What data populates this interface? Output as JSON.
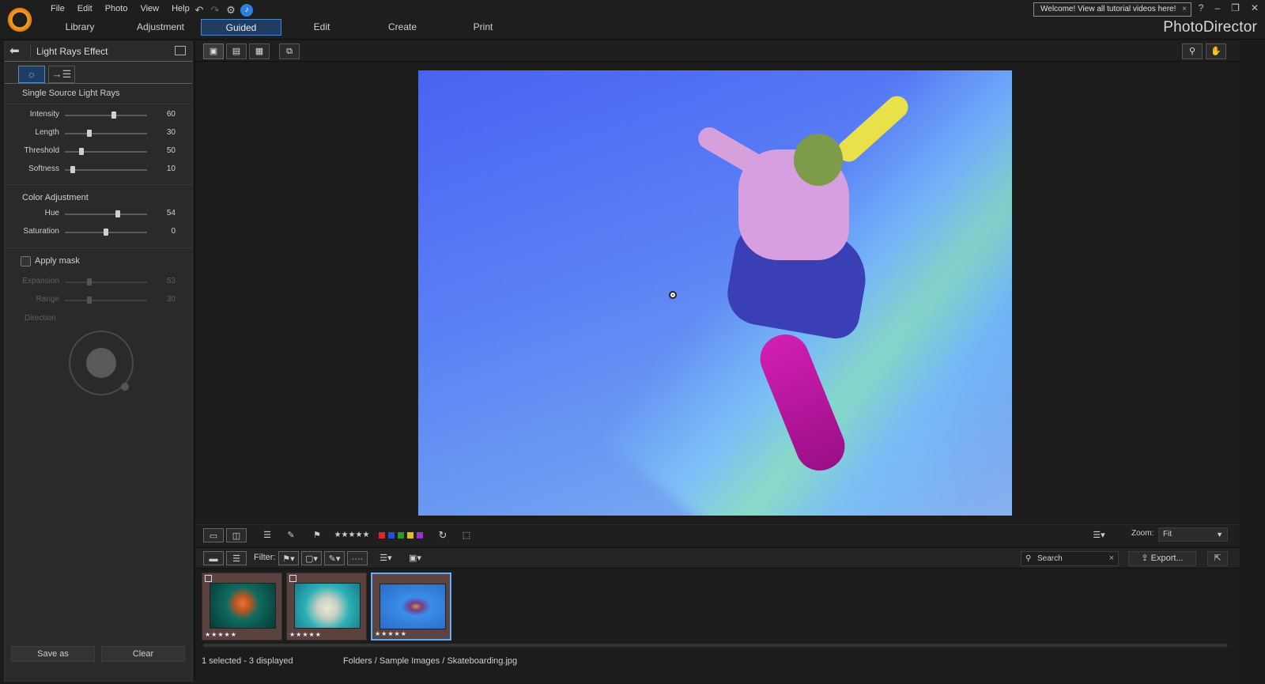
{
  "menu": [
    "File",
    "Edit",
    "Photo",
    "View",
    "Help"
  ],
  "modes": [
    {
      "label": "Library",
      "active": false
    },
    {
      "label": "Adjustment",
      "active": false
    },
    {
      "label": "Guided",
      "active": true
    },
    {
      "label": "Edit",
      "active": false
    },
    {
      "label": "Create",
      "active": false
    },
    {
      "label": "Print",
      "active": false
    }
  ],
  "welcome": {
    "text": "Welcome! View all tutorial videos here!",
    "close": "×"
  },
  "window_controls": {
    "help": "?",
    "minimize": "–",
    "restore": "❐",
    "close": "✕"
  },
  "brand": "PhotoDirector",
  "panel": {
    "title": "Light Rays Effect",
    "tabs": [
      "☼",
      "→☰"
    ],
    "section1": "Single Source Light Rays",
    "sliders1": [
      {
        "label": "Intensity",
        "value": "60",
        "pos": 0.6
      },
      {
        "label": "Length",
        "value": "30",
        "pos": 0.3
      },
      {
        "label": "Threshold",
        "value": "50",
        "pos": 0.2
      },
      {
        "label": "Softness",
        "value": "10",
        "pos": 0.1
      }
    ],
    "section2": "Color Adjustment",
    "sliders2": [
      {
        "label": "Hue",
        "value": "54",
        "pos": 0.64
      },
      {
        "label": "Saturation",
        "value": "0",
        "pos": 0.5
      }
    ],
    "apply_mask": "Apply mask",
    "sliders3": [
      {
        "label": "Expansion",
        "value": "53",
        "pos": 0.3
      },
      {
        "label": "Range",
        "value": "30",
        "pos": 0.3
      }
    ],
    "direction": "Direction",
    "save_as": "Save as",
    "clear": "Clear"
  },
  "toolbar": {
    "stars": "★★★★★",
    "color_labels": [
      "#e02424",
      "#2050e0",
      "#2a9a2a",
      "#e0c020",
      "#9a30d0"
    ],
    "zoom_label": "Zoom:",
    "zoom_value": "Fit",
    "filter_label": "Filter:",
    "search_placeholder": "Search",
    "export_label": "Export..."
  },
  "thumbnails": [
    {
      "stars": "★★★★★",
      "selected": false,
      "colors": [
        "#0f6b5f",
        "#e0763a"
      ]
    },
    {
      "stars": "★★★★★",
      "selected": false,
      "colors": [
        "#2bb0b8",
        "#d8d8c8"
      ]
    },
    {
      "stars": "★★★★★",
      "selected": true,
      "colors": [
        "#3a8ee8",
        "#c8a030"
      ]
    }
  ],
  "status": {
    "selection": "1 selected - 3 displayed",
    "path": "Folders / Sample Images / Skateboarding.jpg"
  }
}
